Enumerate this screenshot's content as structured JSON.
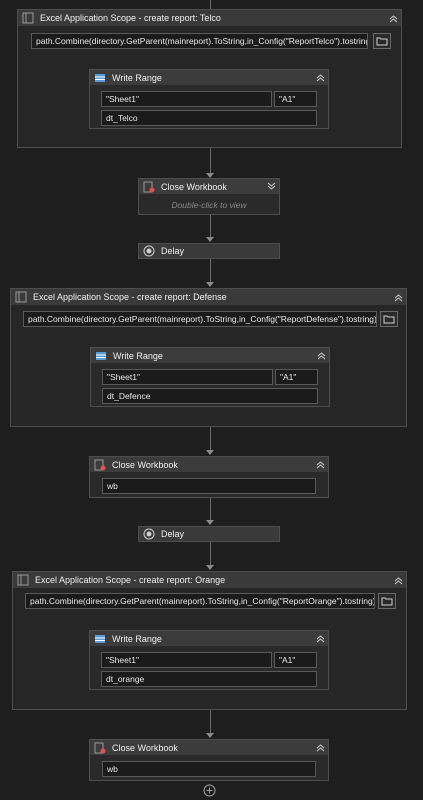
{
  "scopes": [
    {
      "title": "Excel Application Scope - create report: Telco",
      "path": "path.Combine(directory.GetParent(mainreport).ToString,in_Config(\"ReportTelco\").tostring)",
      "write_range": {
        "title": "Write Range",
        "sheet": "\"Sheet1\"",
        "cell": "\"A1\"",
        "datatable": "dt_Telco"
      }
    },
    {
      "title": "Excel Application Scope - create report: Defense",
      "path": "path.Combine(directory.GetParent(mainreport).ToString,in_Config(\"ReportDefense\").tostring)",
      "write_range": {
        "title": "Write Range",
        "sheet": "\"Sheet1\"",
        "cell": "\"A1\"",
        "datatable": "dt_Defence"
      }
    },
    {
      "title": "Excel Application Scope - create report: Orange",
      "path": "path.Combine(directory.GetParent(mainreport).ToString,in_Config(\"ReportOrange\").tostring)",
      "write_range": {
        "title": "Write Range",
        "sheet": "\"Sheet1\"",
        "cell": "\"A1\"",
        "datatable": "dt_orange"
      }
    }
  ],
  "close_workbook_1": {
    "title": "Close Workbook",
    "hint": "Double-click to view"
  },
  "close_workbook_2": {
    "title": "Close Workbook",
    "workbook": "wb"
  },
  "close_workbook_3": {
    "title": "Close Workbook",
    "workbook": "wb"
  },
  "delay_1": {
    "title": "Delay"
  },
  "delay_2": {
    "title": "Delay"
  },
  "icons": {
    "scope": "excel-scope-icon",
    "write_range": "write-range-icon",
    "close_workbook": "close-workbook-icon",
    "delay": "delay-icon",
    "folder": "folder-icon",
    "add": "add-activity-icon"
  },
  "colors": {
    "canvas": "#1e1e1e",
    "header": "#3a3a3a",
    "border": "#4e4e4e",
    "write_range_icon": "#5b9bd5",
    "close_icon_accent": "#d9534f"
  }
}
